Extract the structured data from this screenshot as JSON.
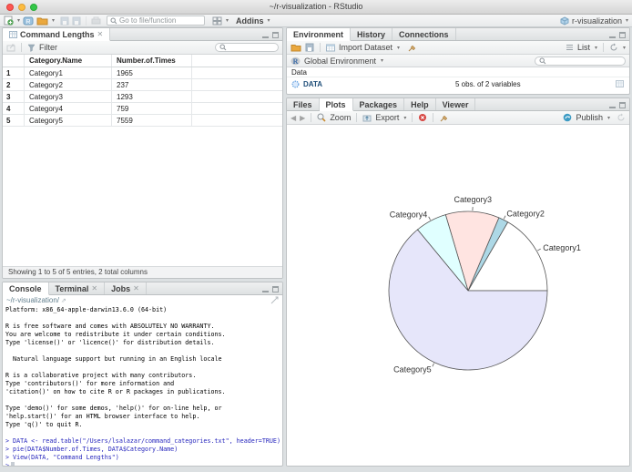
{
  "window": {
    "title": "~/r-visualization - RStudio"
  },
  "toolbar": {
    "goto_placeholder": "Go to file/function",
    "addins": "Addins",
    "project": "r-visualization"
  },
  "data_viewer": {
    "tab": "Command Lengths",
    "filter_button": "Filter",
    "columns": {
      "name": "Category.Name",
      "times": "Number.of.Times"
    },
    "rows": [
      [
        "1",
        "Category1",
        "1965"
      ],
      [
        "2",
        "Category2",
        "237"
      ],
      [
        "3",
        "Category3",
        "1293"
      ],
      [
        "4",
        "Category4",
        "759"
      ],
      [
        "5",
        "Category5",
        "7559"
      ]
    ],
    "status": "Showing 1 to 5 of 5 entries, 2 total columns"
  },
  "console_panel": {
    "tab_console": "Console",
    "tab_terminal": "Terminal",
    "tab_jobs": "Jobs",
    "path": "~/r-visualization/",
    "prompt": ">",
    "lines": [
      {
        "k": "out",
        "text": "Platform: x86_64-apple-darwin13.6.0 (64-bit)"
      },
      {
        "k": "out",
        "text": ""
      },
      {
        "k": "out",
        "text": "R is free software and comes with ABSOLUTELY NO WARRANTY."
      },
      {
        "k": "out",
        "text": "You are welcome to redistribute it under certain conditions."
      },
      {
        "k": "out",
        "text": "Type 'license()' or 'licence()' for distribution details."
      },
      {
        "k": "out",
        "text": ""
      },
      {
        "k": "out",
        "text": "  Natural language support but running in an English locale"
      },
      {
        "k": "out",
        "text": ""
      },
      {
        "k": "out",
        "text": "R is a collaborative project with many contributors."
      },
      {
        "k": "out",
        "text": "Type 'contributors()' for more information and"
      },
      {
        "k": "out",
        "text": "'citation()' on how to cite R or R packages in publications."
      },
      {
        "k": "out",
        "text": ""
      },
      {
        "k": "out",
        "text": "Type 'demo()' for some demos, 'help()' for on-line help, or"
      },
      {
        "k": "out",
        "text": "'help.start()' for an HTML browser interface to help."
      },
      {
        "k": "out",
        "text": "Type 'q()' to quit R."
      },
      {
        "k": "out",
        "text": ""
      },
      {
        "k": "in",
        "text": "> DATA <- read.table(\"/Users/lsalazar/command_categories.txt\", header=TRUE)"
      },
      {
        "k": "in",
        "text": "> pie(DATA$Number.of.Times, DATA$Category.Name)"
      },
      {
        "k": "in",
        "text": "> View(DATA, \"Command Lengths\")"
      }
    ]
  },
  "environment_panel": {
    "tab_environment": "Environment",
    "tab_history": "History",
    "tab_connections": "Connections",
    "import_dataset": "Import Dataset",
    "list_label": "List",
    "scope": "Global Environment",
    "section_data": "Data",
    "object": {
      "name": "DATA",
      "desc": "5 obs. of 2 variables"
    }
  },
  "plots_panel": {
    "tab_files": "Files",
    "tab_plots": "Plots",
    "tab_packages": "Packages",
    "tab_help": "Help",
    "tab_viewer": "Viewer",
    "zoom_label": "Zoom",
    "export_label": "Export",
    "publish_label": "Publish"
  },
  "chart_data": {
    "type": "pie",
    "title": "",
    "categories": [
      "Category1",
      "Category2",
      "Category3",
      "Category4",
      "Category5"
    ],
    "values": [
      1965,
      237,
      1293,
      759,
      7559
    ],
    "colors": [
      "#FFFFFF",
      "#ADD8E6",
      "#FFE4E1",
      "#E0FFFF",
      "#E6E6FA"
    ],
    "stroke": "#555555",
    "start_angle_deg": 0,
    "direction": "counterclockwise",
    "labels": "outside",
    "legend": "none",
    "center": [
      199,
      182
    ],
    "radius": 87
  }
}
